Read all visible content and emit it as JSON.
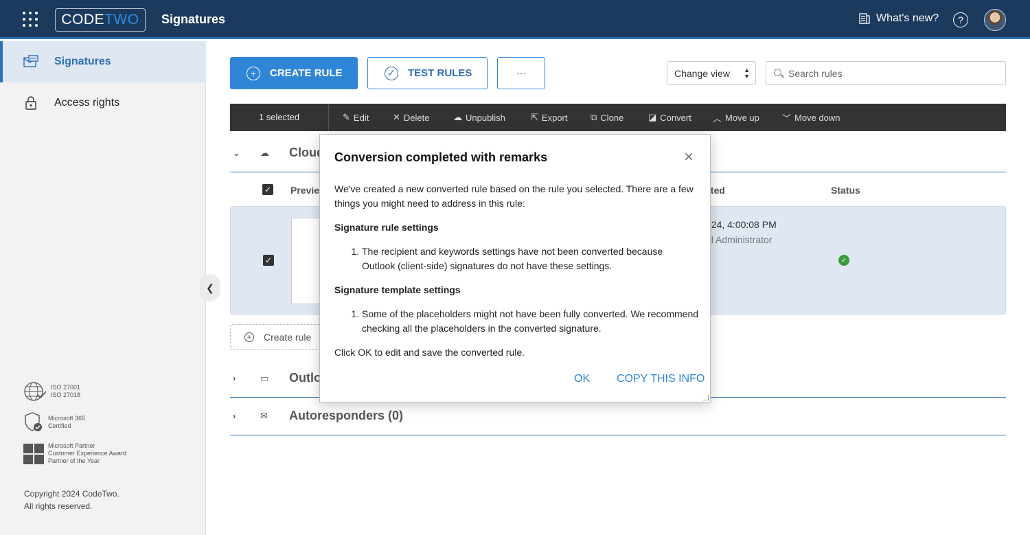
{
  "header": {
    "logo_code": "CODE",
    "logo_two": "TWO",
    "app_title": "Signatures",
    "whats_new": "What's new?",
    "help_glyph": "?"
  },
  "sidebar": {
    "items": [
      {
        "label": "Signatures",
        "icon": "signatures-icon",
        "active": true
      },
      {
        "label": "Access rights",
        "icon": "lock-icon",
        "active": false
      }
    ],
    "certs": [
      {
        "line1": "ISO 27001",
        "line2": "ISO 27018"
      },
      {
        "line1": "Microsoft 365",
        "line2": "Certified"
      },
      {
        "line1": "Microsoft Partner",
        "line2": "Customer Experience Award",
        "line3": "Partner of the Year"
      }
    ],
    "copyright1": "Copyright 2024 CodeTwo.",
    "copyright2": "All rights reserved."
  },
  "toolbar": {
    "create_rule": "CREATE RULE",
    "test_rules": "TEST RULES",
    "more": "···",
    "change_view": "Change view",
    "search_placeholder": "Search rules"
  },
  "actionbar": {
    "selected": "1 selected",
    "edit": "Edit",
    "delete": "Delete",
    "unpublish": "Unpublish",
    "export": "Export",
    "clone": "Clone",
    "convert": "Convert",
    "move_up": "Move up",
    "move_down": "Move down"
  },
  "sections": {
    "cloud_title": "Cloud",
    "outlook_title": "Outlo",
    "autoresponders_title": "Autoresponders (0)"
  },
  "table": {
    "col_preview": "Previe",
    "col_updated": "ated",
    "col_status": "Status",
    "row": {
      "date": "024, 4:00:08 PM",
      "user": "al Administrator"
    },
    "create_rule": "Create rule"
  },
  "modal": {
    "title": "Conversion completed with remarks",
    "close": "×",
    "intro": "We've created a new converted rule based on the rule you selected. There are a few things you might need to address in this rule:",
    "section1_title": "Signature rule settings",
    "section1_item1": "The recipient and keywords settings have not been converted because Outlook (client-side) signatures do not have these settings.",
    "section2_title": "Signature template settings",
    "section2_item1": "Some of the placeholders might not have been fully converted. We recommend checking all the placeholders in the converted signature.",
    "outro": "Click OK to edit and save the converted rule.",
    "ok": "OK",
    "copy": "COPY THIS INFO"
  },
  "colors": {
    "header_bg": "#1c3a5e",
    "accent": "#2f86d6",
    "status_ok": "#3a9c3e"
  }
}
